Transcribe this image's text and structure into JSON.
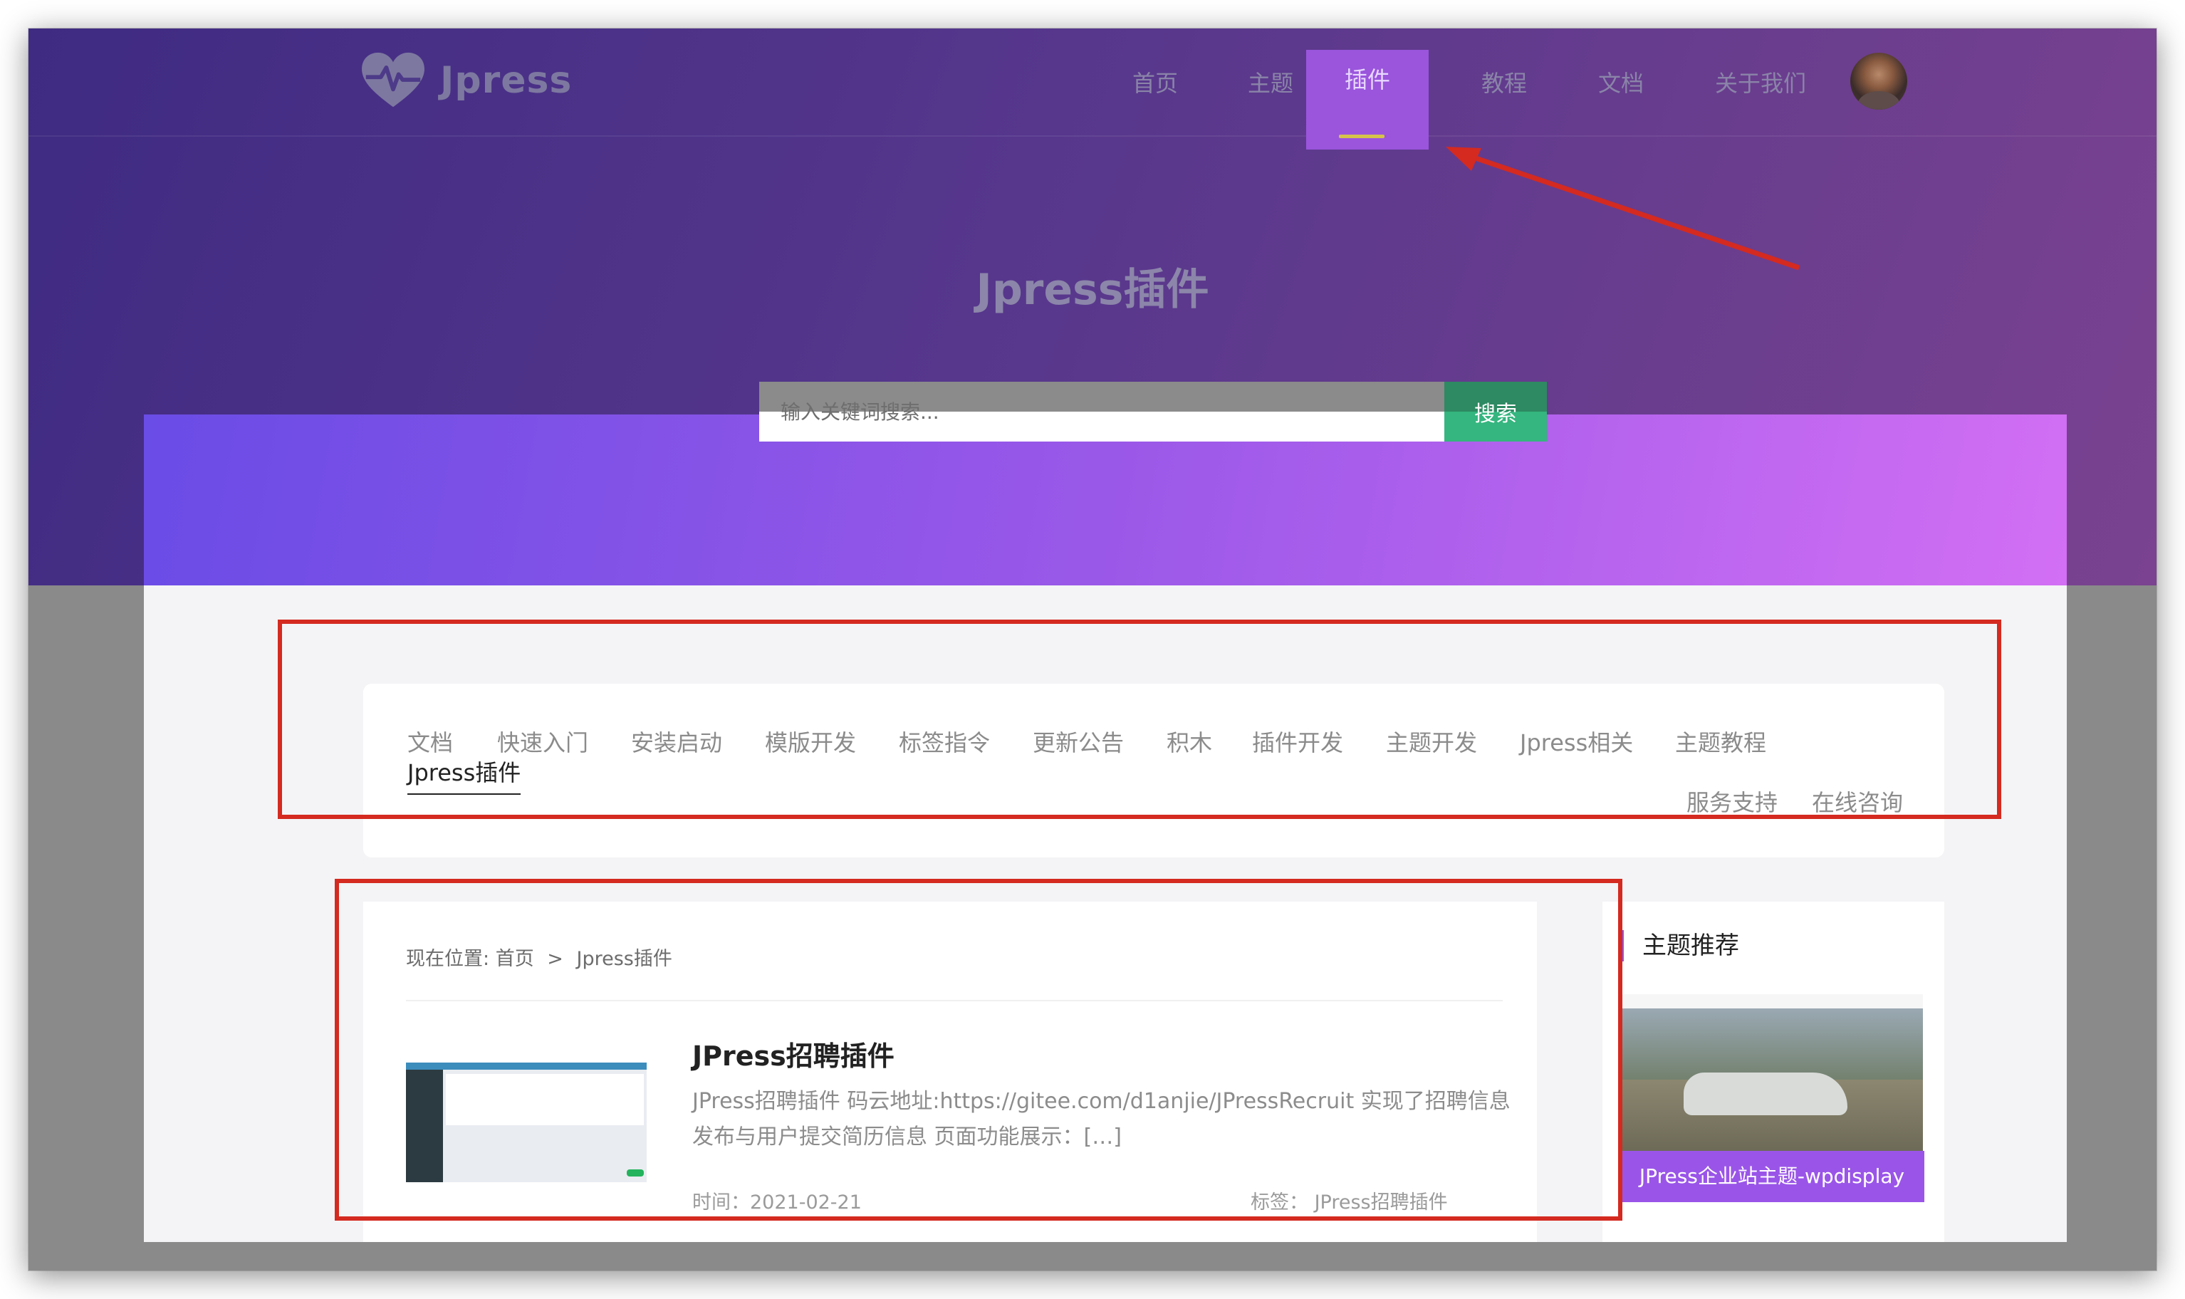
{
  "brand": {
    "name": "Jpress",
    "logo_icon": "heart-pulse-icon"
  },
  "nav": {
    "items": [
      {
        "label": "首页"
      },
      {
        "label": "主题"
      },
      {
        "label": "插件",
        "active": true
      },
      {
        "label": "教程"
      },
      {
        "label": "文档"
      },
      {
        "label": "关于我们"
      }
    ],
    "avatar": "user-avatar"
  },
  "hero": {
    "title": "Jpress插件"
  },
  "search": {
    "placeholder": "输入关键词搜索...",
    "button": "搜索"
  },
  "categories": {
    "items": [
      {
        "label": "文档"
      },
      {
        "label": "快速入门"
      },
      {
        "label": "安装启动"
      },
      {
        "label": "模版开发"
      },
      {
        "label": "标签指令"
      },
      {
        "label": "更新公告"
      },
      {
        "label": "积木"
      },
      {
        "label": "插件开发"
      },
      {
        "label": "主题开发"
      },
      {
        "label": "Jpress相关"
      },
      {
        "label": "主题教程"
      },
      {
        "label": "Jpress插件",
        "active": true
      }
    ],
    "right_links": [
      {
        "label": "服务支持"
      },
      {
        "label": "在线咨询"
      }
    ]
  },
  "breadcrumb": {
    "prefix": "现在位置:",
    "home": "首页",
    "separator": ">",
    "current": "Jpress插件"
  },
  "post": {
    "title": "JPress招聘插件",
    "excerpt": "JPress招聘插件 码云地址:https://gitee.com/d1anjie/JPressRecruit 实现了招聘信息发布与用户提交简历信息 页面功能展示：[…]",
    "time_label": "时间：",
    "time_value": "2021-02-21",
    "tag_label": "标签：",
    "tag_value": "JPress招聘插件"
  },
  "sidebar": {
    "heading": "主题推荐",
    "theme_label": "JPress企业站主题-wpdisplay"
  },
  "colors": {
    "hero_start": "#3f2b82",
    "hero_end": "#7a4290",
    "banner_start": "#6a4ce6",
    "banner_end": "#d26ff4",
    "active_nav": "#9a55dc",
    "search_button": "#35b57f",
    "annotation_red": "#d42a20",
    "accent_purple": "#9055e6"
  }
}
